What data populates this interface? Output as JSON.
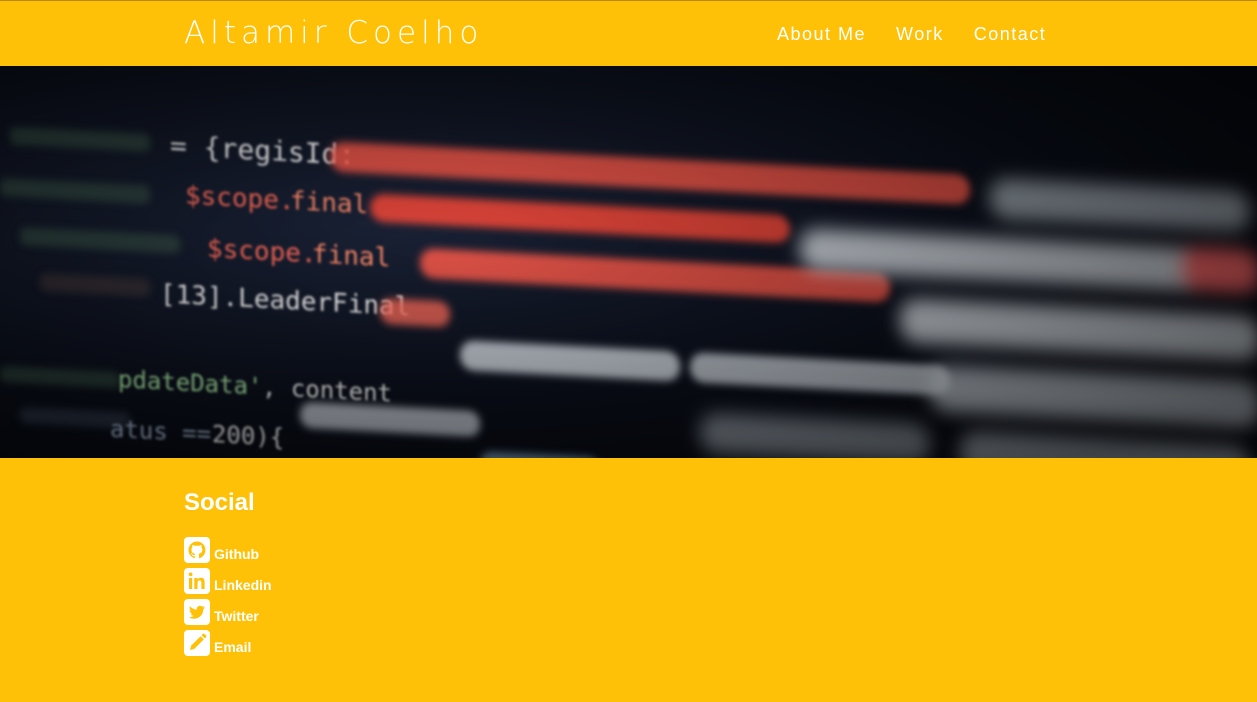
{
  "header": {
    "brand": "Altamir Coelho",
    "nav": [
      {
        "label": "About Me"
      },
      {
        "label": "Work"
      },
      {
        "label": "Contact"
      }
    ]
  },
  "hero": {
    "code_lines": [
      "sendToSend = {regisId: $scope.currentRecord.0000",
      "finalResponse: $scope.finalData[10].HeaderFinalRes",
      "finalRating: $scope.finalData[13].HeaderFinalRating",
      "finalData[13].LeaderFinalRating, (document)",
      "'updateData', contentToSend).then(",
      "if(status == 200){"
    ]
  },
  "social": {
    "title": "Social",
    "links": [
      {
        "label": "Github",
        "icon": "github-icon"
      },
      {
        "label": "Linkedin",
        "icon": "linkedin-icon"
      },
      {
        "label": "Twitter",
        "icon": "twitter-icon"
      },
      {
        "label": "Email",
        "icon": "pencil-icon"
      }
    ]
  },
  "colors": {
    "accent": "#FFC107",
    "text": "#FFFFFF",
    "hero_bg": "#0B0F1A",
    "code_red": "#FF6B5A",
    "code_green": "#A6E3A1",
    "code_white": "#F2F2F2"
  }
}
